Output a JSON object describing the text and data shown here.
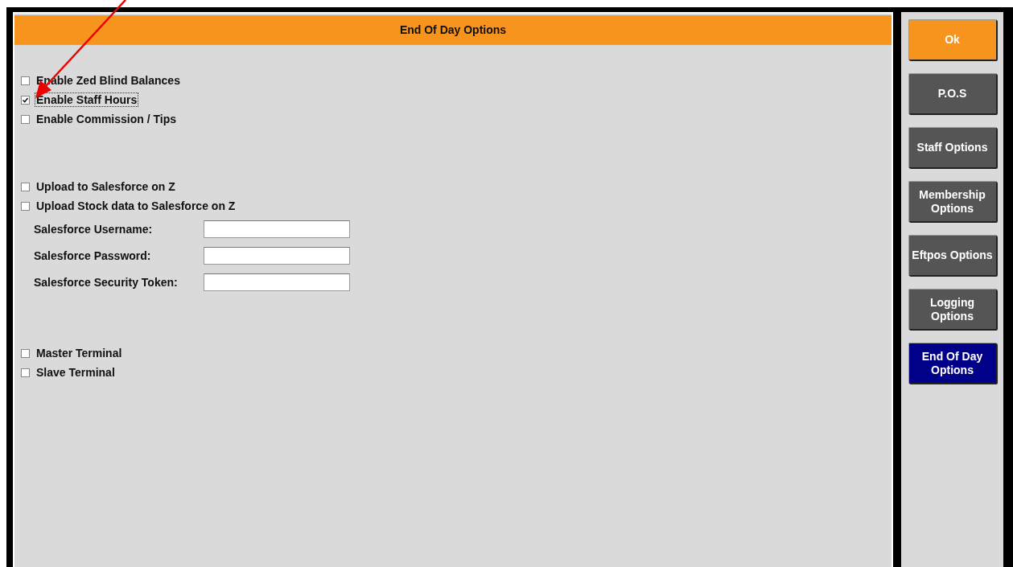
{
  "panel": {
    "title": "End Of Day Options"
  },
  "groups": [
    {
      "items": [
        {
          "kind": "checkbox",
          "label": "Enable Zed Blind Balances",
          "checked": false,
          "focused": false
        },
        {
          "kind": "checkbox",
          "label": "Enable Staff Hours",
          "checked": true,
          "focused": true
        },
        {
          "kind": "checkbox",
          "label": "Enable Commission / Tips",
          "checked": false,
          "focused": false
        }
      ]
    },
    {
      "items": [
        {
          "kind": "checkbox",
          "label": "Upload to Salesforce on Z",
          "checked": false,
          "focused": false
        },
        {
          "kind": "checkbox",
          "label": "Upload Stock data to Salesforce on Z",
          "checked": false,
          "focused": false
        },
        {
          "kind": "field",
          "label": "Salesforce Username:"
        },
        {
          "kind": "field",
          "label": "Salesforce Password:"
        },
        {
          "kind": "field",
          "label": "Salesforce Security Token:"
        }
      ]
    },
    {
      "items": [
        {
          "kind": "checkbox",
          "label": "Master Terminal",
          "checked": false,
          "focused": false
        },
        {
          "kind": "checkbox",
          "label": "Slave Terminal",
          "checked": false,
          "focused": false
        }
      ]
    }
  ],
  "sidebar": {
    "ok": "Ok",
    "items": [
      {
        "label": "P.O.S",
        "selected": false
      },
      {
        "label": "Staff Options",
        "selected": false
      },
      {
        "label": "Membership Options",
        "selected": false
      },
      {
        "label": "Eftpos Options",
        "selected": false
      },
      {
        "label": "Logging Options",
        "selected": false
      },
      {
        "label": "End Of Day Options",
        "selected": true
      }
    ]
  }
}
